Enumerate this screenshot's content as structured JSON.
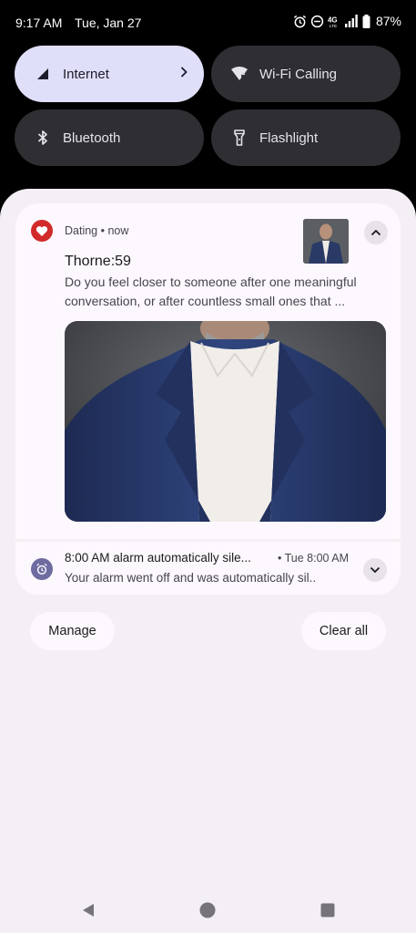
{
  "status_bar": {
    "time": "9:17 AM",
    "date": "Tue, Jan 27",
    "battery": "87%",
    "icons": [
      "alarm-icon",
      "do-not-disturb-icon",
      "4g-lte-icon",
      "signal-icon",
      "battery-icon"
    ]
  },
  "quick_settings": {
    "tiles": [
      {
        "label": "Internet",
        "icon": "signal-icon",
        "active": true
      },
      {
        "label": "Wi-Fi Calling",
        "icon": "wifi-calling-icon",
        "active": false
      },
      {
        "label": "Bluetooth",
        "icon": "bluetooth-icon",
        "active": false
      },
      {
        "label": "Flashlight",
        "icon": "flashlight-icon",
        "active": false
      }
    ]
  },
  "notifications": [
    {
      "app": "Dating",
      "time": "now",
      "header": "Dating • now",
      "title": "Thorne:59",
      "body": "Do you feel closer to someone after one meaningful conversation, or after countless small ones that ...",
      "accent": "#d22a2a"
    },
    {
      "title": "8:00 AM alarm automatically sile...",
      "time": "• Tue 8:00 AM",
      "body": "Your alarm went off and was automatically sil..",
      "accent": "#6d6b9f"
    }
  ],
  "actions": {
    "manage": "Manage",
    "clear_all": "Clear all"
  },
  "colors": {
    "shade_bg": "#f3eff5",
    "card_bg": "#fdf8fd",
    "tile_active": "#e0dff9",
    "tile_inactive": "#2e2e33"
  }
}
